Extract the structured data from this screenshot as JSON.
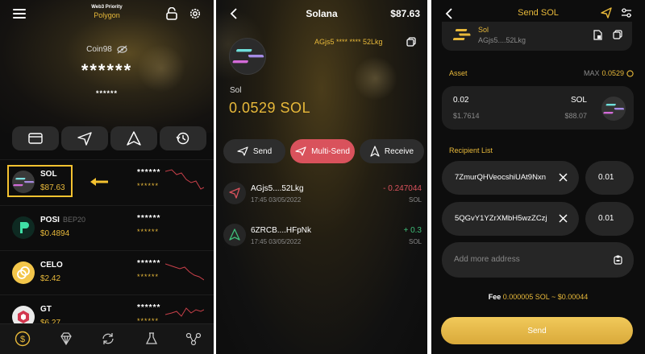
{
  "wallet": {
    "header_small": "Web3 Priority",
    "network": "Polygon",
    "account_name": "Coin98",
    "balance_hidden": "******",
    "balance_hidden_small": "******",
    "coins": [
      {
        "symbol": "SOL",
        "sub": "",
        "price": "$87.63",
        "stars1": "******",
        "stars2": "******",
        "color": "#2b2a2a"
      },
      {
        "symbol": "POSI",
        "sub": "BEP20",
        "price": "$0.4894",
        "stars1": "******",
        "stars2": "******",
        "color": "#0f2d26"
      },
      {
        "symbol": "CELO",
        "sub": "",
        "price": "$2.42",
        "stars1": "******",
        "stars2": "******",
        "color": "#f4c542"
      },
      {
        "symbol": "GT",
        "sub": "",
        "price": "$6.27",
        "stars1": "******",
        "stars2": "******",
        "color": "#e9e9e9"
      }
    ]
  },
  "token_detail": {
    "title": "Solana",
    "header_value": "$87.63",
    "address": "AGjs5 **** **** 52Lkg",
    "token_label": "Sol",
    "balance": "0.0529 SOL",
    "send_label": "Send",
    "multisend_label": "Multi-Send",
    "receive_label": "Receive",
    "transactions": [
      {
        "addr": "AGjs5....52Lkg",
        "time": "17:45 03/05/2022",
        "amount": "- 0.247044",
        "unit": "SOL",
        "dir": "out"
      },
      {
        "addr": "6ZRCB....HFpNk",
        "time": "17:45 03/05/2022",
        "amount": "+ 0.3",
        "unit": "SOL",
        "dir": "in"
      }
    ]
  },
  "send_screen": {
    "title": "Send SOL",
    "from_token": "Sol",
    "from_address": "AGjs5....52Lkg",
    "asset_label": "Asset",
    "max_label": "MAX",
    "max_value": "0.0529",
    "asset_amount": "0.02",
    "asset_symbol": "SOL",
    "asset_usd": "$1.7614",
    "asset_usd_right": "$88.07",
    "recipient_label": "Recipient List",
    "recipients": [
      {
        "address": "7ZmurQHVeocshiUAt9Nxn",
        "amount": "0.01"
      },
      {
        "address": "5QGvY1YZrXMbH5wzZCzj",
        "amount": "0.01"
      }
    ],
    "add_placeholder": "Add more address",
    "fee_label": "Fee",
    "fee_value": "0.000005 SOL ~ $0.00044",
    "send_button": "Send"
  }
}
